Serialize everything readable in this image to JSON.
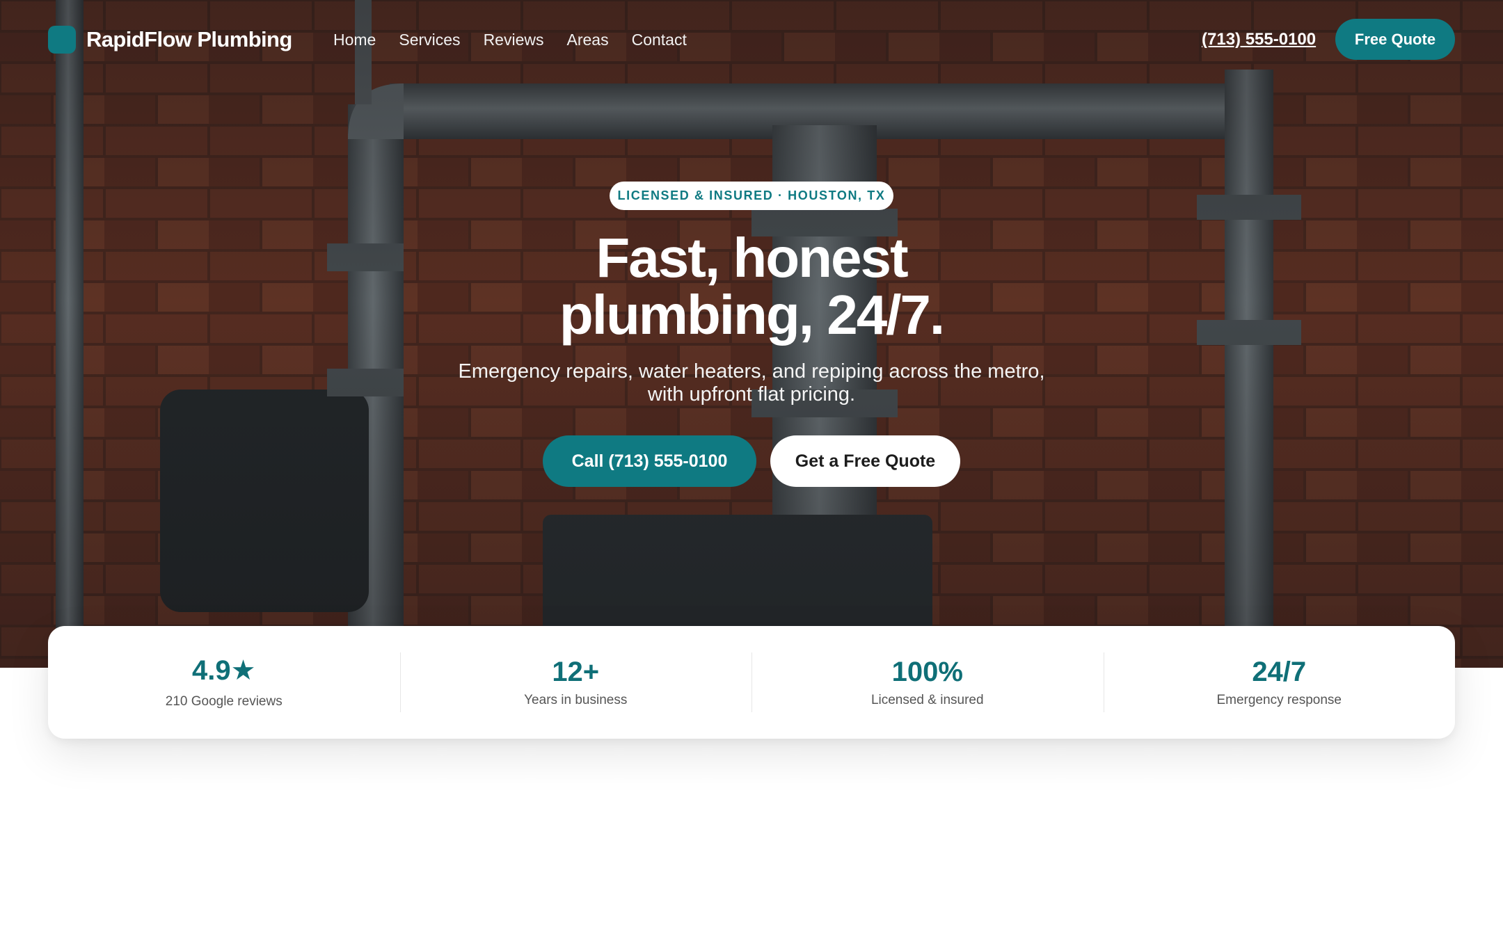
{
  "brand": {
    "name": "RapidFlow Plumbing",
    "accent_color": "#0f7a82"
  },
  "nav": {
    "links": [
      "Home",
      "Services",
      "Reviews",
      "Areas",
      "Contact"
    ],
    "phone": "(713) 555-0100",
    "cta_label": "Free Quote"
  },
  "hero": {
    "badge": "LICENSED & INSURED · HOUSTON, TX",
    "headline_line1": "Fast, honest",
    "headline_line2": "plumbing, 24/7.",
    "subhead_line1": "Emergency repairs, water heaters, and repiping across the metro,",
    "subhead_line2": "with upfront flat pricing.",
    "primary_button": "Call (713) 555-0100",
    "secondary_button": "Get a Free Quote",
    "background_image": "industrial pipes against red brick wall"
  },
  "stats": [
    {
      "value": "4.9",
      "icon": "star-icon",
      "label": "210 Google reviews"
    },
    {
      "value": "12+",
      "label": "Years in business"
    },
    {
      "value": "100%",
      "label": "Licensed & insured"
    },
    {
      "value": "24/7",
      "label": "Emergency response"
    }
  ]
}
